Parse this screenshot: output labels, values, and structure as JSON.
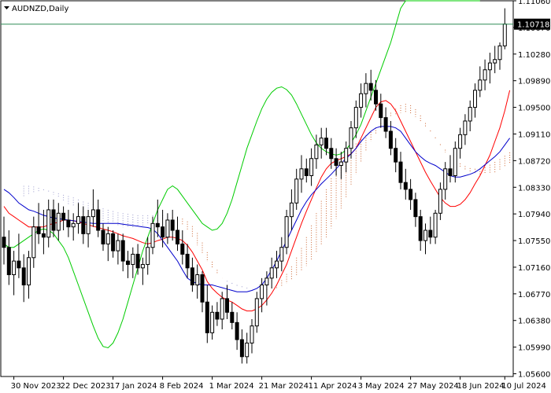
{
  "chart_data": {
    "type": "candlestick",
    "title": "AUDNZD,Daily",
    "symbol": "AUDNZD",
    "timeframe": "Daily",
    "ylim": [
      1.0556,
      1.1106
    ],
    "y_ticks": [
      "1.11060",
      "1.10670",
      "1.10280",
      "1.09890",
      "1.09500",
      "1.09110",
      "1.08720",
      "1.08330",
      "1.07940",
      "1.07550",
      "1.07160",
      "1.06770",
      "1.06380",
      "1.05990",
      "1.05600"
    ],
    "current_price": "1.10718",
    "x_ticks": [
      "30 Nov 2023",
      "22 Dec 2023",
      "17 Jan 2024",
      "8 Feb 2024",
      "1 Mar 2024",
      "21 Mar 2024",
      "11 Apr 2024",
      "3 May 2024",
      "27 May 2024",
      "18 Jun 2024",
      "10 Jul 2024"
    ],
    "candles": [
      {
        "o": 1.076,
        "h": 1.079,
        "l": 1.072,
        "c": 1.0745
      },
      {
        "o": 1.0745,
        "h": 1.077,
        "l": 1.069,
        "c": 1.0705
      },
      {
        "o": 1.0705,
        "h": 1.074,
        "l": 1.0675,
        "c": 1.0725
      },
      {
        "o": 1.0725,
        "h": 1.0765,
        "l": 1.07,
        "c": 1.0715
      },
      {
        "o": 1.0715,
        "h": 1.0735,
        "l": 1.0665,
        "c": 1.069
      },
      {
        "o": 1.069,
        "h": 1.074,
        "l": 1.067,
        "c": 1.073
      },
      {
        "o": 1.073,
        "h": 1.079,
        "l": 1.0715,
        "c": 1.0775
      },
      {
        "o": 1.0775,
        "h": 1.081,
        "l": 1.075,
        "c": 1.0765
      },
      {
        "o": 1.0765,
        "h": 1.08,
        "l": 1.0735,
        "c": 1.076
      },
      {
        "o": 1.076,
        "h": 1.0815,
        "l": 1.0745,
        "c": 1.08
      },
      {
        "o": 1.08,
        "h": 1.0815,
        "l": 1.076,
        "c": 1.077
      },
      {
        "o": 1.077,
        "h": 1.081,
        "l": 1.0755,
        "c": 1.0795
      },
      {
        "o": 1.0795,
        "h": 1.0805,
        "l": 1.077,
        "c": 1.0785
      },
      {
        "o": 1.0785,
        "h": 1.08,
        "l": 1.076,
        "c": 1.0775
      },
      {
        "o": 1.0775,
        "h": 1.0795,
        "l": 1.0755,
        "c": 1.078
      },
      {
        "o": 1.078,
        "h": 1.081,
        "l": 1.0765,
        "c": 1.079
      },
      {
        "o": 1.079,
        "h": 1.0805,
        "l": 1.075,
        "c": 1.0765
      },
      {
        "o": 1.0765,
        "h": 1.08,
        "l": 1.0745,
        "c": 1.079
      },
      {
        "o": 1.079,
        "h": 1.083,
        "l": 1.0775,
        "c": 1.08
      },
      {
        "o": 1.08,
        "h": 1.0815,
        "l": 1.076,
        "c": 1.077
      },
      {
        "o": 1.077,
        "h": 1.078,
        "l": 1.074,
        "c": 1.075
      },
      {
        "o": 1.075,
        "h": 1.0775,
        "l": 1.0725,
        "c": 1.0765
      },
      {
        "o": 1.0765,
        "h": 1.077,
        "l": 1.073,
        "c": 1.074
      },
      {
        "o": 1.074,
        "h": 1.0765,
        "l": 1.072,
        "c": 1.0755
      },
      {
        "o": 1.0755,
        "h": 1.0765,
        "l": 1.071,
        "c": 1.0725
      },
      {
        "o": 1.0725,
        "h": 1.074,
        "l": 1.07,
        "c": 1.072
      },
      {
        "o": 1.072,
        "h": 1.0745,
        "l": 1.07,
        "c": 1.0735
      },
      {
        "o": 1.0735,
        "h": 1.075,
        "l": 1.0705,
        "c": 1.0715
      },
      {
        "o": 1.0715,
        "h": 1.073,
        "l": 1.069,
        "c": 1.072
      },
      {
        "o": 1.072,
        "h": 1.076,
        "l": 1.0705,
        "c": 1.0745
      },
      {
        "o": 1.0745,
        "h": 1.079,
        "l": 1.0735,
        "c": 1.078
      },
      {
        "o": 1.078,
        "h": 1.0815,
        "l": 1.076,
        "c": 1.0775
      },
      {
        "o": 1.0775,
        "h": 1.08,
        "l": 1.0745,
        "c": 1.076
      },
      {
        "o": 1.076,
        "h": 1.0795,
        "l": 1.075,
        "c": 1.0785
      },
      {
        "o": 1.0785,
        "h": 1.08,
        "l": 1.0755,
        "c": 1.077
      },
      {
        "o": 1.077,
        "h": 1.079,
        "l": 1.074,
        "c": 1.075
      },
      {
        "o": 1.075,
        "h": 1.077,
        "l": 1.072,
        "c": 1.0735
      },
      {
        "o": 1.0735,
        "h": 1.075,
        "l": 1.07,
        "c": 1.0715
      },
      {
        "o": 1.0715,
        "h": 1.073,
        "l": 1.068,
        "c": 1.069
      },
      {
        "o": 1.069,
        "h": 1.072,
        "l": 1.067,
        "c": 1.0705
      },
      {
        "o": 1.0705,
        "h": 1.071,
        "l": 1.065,
        "c": 1.0665
      },
      {
        "o": 1.0665,
        "h": 1.069,
        "l": 1.0605,
        "c": 1.062
      },
      {
        "o": 1.062,
        "h": 1.066,
        "l": 1.061,
        "c": 1.065
      },
      {
        "o": 1.065,
        "h": 1.0665,
        "l": 1.063,
        "c": 1.064
      },
      {
        "o": 1.064,
        "h": 1.068,
        "l": 1.0625,
        "c": 1.067
      },
      {
        "o": 1.067,
        "h": 1.069,
        "l": 1.064,
        "c": 1.065
      },
      {
        "o": 1.065,
        "h": 1.0665,
        "l": 1.0625,
        "c": 1.0635
      },
      {
        "o": 1.0635,
        "h": 1.065,
        "l": 1.0595,
        "c": 1.061
      },
      {
        "o": 1.061,
        "h": 1.0625,
        "l": 1.0575,
        "c": 1.0585
      },
      {
        "o": 1.0585,
        "h": 1.062,
        "l": 1.0575,
        "c": 1.0605
      },
      {
        "o": 1.0605,
        "h": 1.064,
        "l": 1.059,
        "c": 1.063
      },
      {
        "o": 1.063,
        "h": 1.068,
        "l": 1.062,
        "c": 1.067
      },
      {
        "o": 1.067,
        "h": 1.07,
        "l": 1.065,
        "c": 1.069
      },
      {
        "o": 1.069,
        "h": 1.071,
        "l": 1.066,
        "c": 1.07
      },
      {
        "o": 1.07,
        "h": 1.073,
        "l": 1.0685,
        "c": 1.0715
      },
      {
        "o": 1.0715,
        "h": 1.074,
        "l": 1.07,
        "c": 1.0725
      },
      {
        "o": 1.0725,
        "h": 1.076,
        "l": 1.071,
        "c": 1.0745
      },
      {
        "o": 1.0745,
        "h": 1.08,
        "l": 1.0735,
        "c": 1.079
      },
      {
        "o": 1.079,
        "h": 1.083,
        "l": 1.077,
        "c": 1.081
      },
      {
        "o": 1.081,
        "h": 1.086,
        "l": 1.08,
        "c": 1.0845
      },
      {
        "o": 1.0845,
        "h": 1.088,
        "l": 1.0825,
        "c": 1.086
      },
      {
        "o": 1.086,
        "h": 1.0875,
        "l": 1.084,
        "c": 1.085
      },
      {
        "o": 1.085,
        "h": 1.089,
        "l": 1.0835,
        "c": 1.0875
      },
      {
        "o": 1.0875,
        "h": 1.091,
        "l": 1.086,
        "c": 1.0895
      },
      {
        "o": 1.0895,
        "h": 1.092,
        "l": 1.0875,
        "c": 1.0905
      },
      {
        "o": 1.0905,
        "h": 1.092,
        "l": 1.088,
        "c": 1.089
      },
      {
        "o": 1.089,
        "h": 1.0905,
        "l": 1.086,
        "c": 1.0875
      },
      {
        "o": 1.0875,
        "h": 1.089,
        "l": 1.085,
        "c": 1.0865
      },
      {
        "o": 1.0865,
        "h": 1.0885,
        "l": 1.0845,
        "c": 1.087
      },
      {
        "o": 1.087,
        "h": 1.09,
        "l": 1.0855,
        "c": 1.089
      },
      {
        "o": 1.089,
        "h": 1.093,
        "l": 1.0875,
        "c": 1.092
      },
      {
        "o": 1.092,
        "h": 1.096,
        "l": 1.0905,
        "c": 1.095
      },
      {
        "o": 1.095,
        "h": 1.0985,
        "l": 1.0935,
        "c": 1.097
      },
      {
        "o": 1.097,
        "h": 1.1,
        "l": 1.095,
        "c": 1.0985
      },
      {
        "o": 1.0985,
        "h": 1.1005,
        "l": 1.096,
        "c": 1.0975
      },
      {
        "o": 1.0975,
        "h": 1.099,
        "l": 1.0945,
        "c": 1.0955
      },
      {
        "o": 1.0955,
        "h": 1.097,
        "l": 1.092,
        "c": 1.0935
      },
      {
        "o": 1.0935,
        "h": 1.095,
        "l": 1.0905,
        "c": 1.0915
      },
      {
        "o": 1.0915,
        "h": 1.093,
        "l": 1.088,
        "c": 1.089
      },
      {
        "o": 1.089,
        "h": 1.0905,
        "l": 1.0855,
        "c": 1.087
      },
      {
        "o": 1.087,
        "h": 1.0885,
        "l": 1.083,
        "c": 1.084
      },
      {
        "o": 1.084,
        "h": 1.086,
        "l": 1.0815,
        "c": 1.083
      },
      {
        "o": 1.083,
        "h": 1.0845,
        "l": 1.08,
        "c": 1.0815
      },
      {
        "o": 1.0815,
        "h": 1.0825,
        "l": 1.0775,
        "c": 1.079
      },
      {
        "o": 1.079,
        "h": 1.08,
        "l": 1.074,
        "c": 1.0755
      },
      {
        "o": 1.0755,
        "h": 1.078,
        "l": 1.0735,
        "c": 1.077
      },
      {
        "o": 1.077,
        "h": 1.079,
        "l": 1.075,
        "c": 1.076
      },
      {
        "o": 1.076,
        "h": 1.08,
        "l": 1.075,
        "c": 1.0795
      },
      {
        "o": 1.0795,
        "h": 1.084,
        "l": 1.0785,
        "c": 1.083
      },
      {
        "o": 1.083,
        "h": 1.087,
        "l": 1.0815,
        "c": 1.086
      },
      {
        "o": 1.086,
        "h": 1.088,
        "l": 1.084,
        "c": 1.085
      },
      {
        "o": 1.085,
        "h": 1.09,
        "l": 1.084,
        "c": 1.089
      },
      {
        "o": 1.089,
        "h": 1.092,
        "l": 1.0875,
        "c": 1.091
      },
      {
        "o": 1.091,
        "h": 1.094,
        "l": 1.0895,
        "c": 1.093
      },
      {
        "o": 1.093,
        "h": 1.096,
        "l": 1.0915,
        "c": 1.095
      },
      {
        "o": 1.095,
        "h": 1.0985,
        "l": 1.0935,
        "c": 1.0975
      },
      {
        "o": 1.0975,
        "h": 1.101,
        "l": 1.0965,
        "c": 1.099
      },
      {
        "o": 1.099,
        "h": 1.102,
        "l": 1.0975,
        "c": 1.1005
      },
      {
        "o": 1.1005,
        "h": 1.103,
        "l": 1.0985,
        "c": 1.1015
      },
      {
        "o": 1.1015,
        "h": 1.104,
        "l": 1.1,
        "c": 1.102
      },
      {
        "o": 1.102,
        "h": 1.1045,
        "l": 1.1005,
        "c": 1.104
      },
      {
        "o": 1.104,
        "h": 1.1095,
        "l": 1.1035,
        "c": 1.1072
      }
    ],
    "series": [
      {
        "values": [
          1.0805,
          1.0795,
          1.079,
          1.0785,
          1.078,
          1.0775,
          1.0775,
          1.0775,
          1.0775,
          1.0778,
          1.078,
          1.0782,
          1.0785,
          1.0785,
          1.0784,
          1.0782,
          1.078,
          1.0778,
          1.0776,
          1.0774,
          1.0772,
          1.077,
          1.0768,
          1.0765,
          1.0762,
          1.076,
          1.0758,
          1.0755,
          1.0752,
          1.075,
          1.0752,
          1.0755,
          1.0757,
          1.076,
          1.076,
          1.0758,
          1.0755,
          1.0748,
          1.0738,
          1.0725,
          1.0712,
          1.0695,
          1.0685,
          1.0678,
          1.0672,
          1.0668,
          1.0665,
          1.066,
          1.0655,
          1.0652,
          1.0652,
          1.0655,
          1.066,
          1.0668,
          1.0678,
          1.069,
          1.0705,
          1.072,
          1.074,
          1.076,
          1.078,
          1.0798,
          1.0815,
          1.0832,
          1.0848,
          1.086,
          1.0868,
          1.0872,
          1.0875,
          1.0878,
          1.0882,
          1.089,
          1.0905,
          1.092,
          1.0935,
          1.095,
          1.0958,
          1.096,
          1.0955,
          1.0945,
          1.093,
          1.0915,
          1.09,
          1.0885,
          1.087,
          1.0855,
          1.0842,
          1.083,
          1.0818,
          1.081,
          1.0805,
          1.0805,
          1.0808,
          1.0815,
          1.0825,
          1.0838,
          1.085,
          1.0865,
          1.088,
          1.09,
          1.092,
          1.0945,
          1.0975
        ]
      },
      {
        "values": [
          1.083,
          1.0825,
          1.0818,
          1.081,
          1.0805,
          1.08,
          1.0798,
          1.0795,
          1.0792,
          1.079,
          1.0788,
          1.0787,
          1.0786,
          1.0785,
          1.0784,
          1.0783,
          1.0782,
          1.0781,
          1.078,
          1.078,
          1.078,
          1.078,
          1.078,
          1.078,
          1.0779,
          1.0778,
          1.0777,
          1.0776,
          1.0775,
          1.0774,
          1.0772,
          1.0765,
          1.0755,
          1.0745,
          1.0735,
          1.0725,
          1.0712,
          1.07,
          1.0695,
          1.0692,
          1.069,
          1.069,
          1.069,
          1.0688,
          1.0686,
          1.0684,
          1.0682,
          1.068,
          1.068,
          1.068,
          1.0682,
          1.0685,
          1.069,
          1.07,
          1.0712,
          1.0725,
          1.074,
          1.0755,
          1.077,
          1.0785,
          1.08,
          1.0812,
          1.0822,
          1.083,
          1.0838,
          1.0845,
          1.0852,
          1.086,
          1.0868,
          1.0875,
          1.0882,
          1.089,
          1.09,
          1.0908,
          1.0915,
          1.092,
          1.0922,
          1.0922,
          1.0922,
          1.092,
          1.0915,
          1.0905,
          1.0895,
          1.0885,
          1.0878,
          1.0872,
          1.0868,
          1.0865,
          1.086,
          1.0855,
          1.085,
          1.0848,
          1.0848,
          1.085,
          1.0852,
          1.0855,
          1.086,
          1.0866,
          1.0872,
          1.0878,
          1.0885,
          1.0895,
          1.0905
        ]
      },
      {
        "values": [
          1.08,
          1.079,
          1.078,
          1.077,
          1.076,
          1.0755,
          1.075,
          1.0745,
          1.0745,
          1.075,
          1.0755,
          1.076,
          1.0765,
          1.077,
          1.0772,
          1.077,
          1.0765,
          1.0755,
          1.0745,
          1.073,
          1.071,
          1.069,
          1.067,
          1.065,
          1.063,
          1.0612,
          1.06,
          1.0598,
          1.0605,
          1.062,
          1.064,
          1.0665,
          1.069,
          1.0715,
          1.074,
          1.076,
          1.078,
          1.08,
          1.0815,
          1.083,
          1.0835,
          1.083,
          1.082,
          1.081,
          1.08,
          1.079,
          1.078,
          1.0775,
          1.077,
          1.0772,
          1.078,
          1.0795,
          1.0815,
          1.084,
          1.0865,
          1.089,
          1.091,
          1.093,
          1.0948,
          1.0962,
          1.0972,
          1.0978,
          1.098,
          1.0976,
          1.0968,
          1.0955,
          1.094,
          1.0925,
          1.091,
          1.0898,
          1.089,
          1.0885,
          1.0882,
          1.088,
          1.0882,
          1.0888,
          1.0898,
          1.091,
          1.0925,
          1.0945,
          1.0965,
          1.0985,
          1.1005,
          1.1025,
          1.1045,
          1.107,
          1.1095,
          1.111,
          1.111,
          1.111,
          1.111,
          1.111,
          1.111,
          1.111,
          1.111,
          1.111,
          1.111,
          1.111,
          1.111,
          1.111,
          1.111,
          1.111,
          1.111
        ]
      }
    ],
    "cloud": {
      "span_a": [
        1.082,
        1.0822,
        1.0824,
        1.0826,
        1.0828,
        1.0826,
        1.0822,
        1.0818,
        1.0812,
        1.0808,
        1.0805,
        1.08,
        1.0796,
        1.0792,
        1.0789,
        1.0786,
        1.0783,
        1.078,
        1.0778,
        1.0776,
        1.0774,
        1.0774,
        1.0774,
        1.0775,
        1.0776,
        1.0778,
        1.078,
        1.0782,
        1.0785,
        1.0787,
        1.0789,
        1.0789,
        1.0787,
        1.0783,
        1.0776,
        1.0766,
        1.0752,
        1.0738,
        1.0724,
        1.0712,
        1.07,
        1.0695,
        1.069,
        1.0688,
        1.0686,
        1.0685,
        1.0684,
        1.0683,
        1.0683,
        1.0684,
        1.0686,
        1.069,
        1.0697,
        1.0706,
        1.0717,
        1.073,
        1.0744,
        1.076,
        1.0777,
        1.0795,
        1.0813,
        1.083,
        1.0846,
        1.086,
        1.0872,
        1.0882,
        1.089,
        1.0897,
        1.0903,
        1.0909,
        1.0914,
        1.092,
        1.0927,
        1.0935,
        1.0942,
        1.0948,
        1.0953,
        1.0955,
        1.0953,
        1.0947,
        1.0938,
        1.0927,
        1.0916,
        1.0906,
        1.0896,
        1.0888,
        1.088,
        1.0874,
        1.0868,
        1.0864,
        1.0861,
        1.086,
        1.086,
        1.0862,
        1.0866,
        1.087,
        1.0874,
        1.0879,
        1.0884,
        1.0889,
        1.0894,
        1.09,
        1.0908
      ],
      "span_b": [
        1.0835,
        1.0835,
        1.0834,
        1.0832,
        1.083,
        1.0828,
        1.0826,
        1.0824,
        1.0822,
        1.082,
        1.0818,
        1.0815,
        1.0812,
        1.081,
        1.0808,
        1.0805,
        1.0802,
        1.08,
        1.0798,
        1.0796,
        1.0795,
        1.0794,
        1.0793,
        1.0792,
        1.0792,
        1.0792,
        1.0792,
        1.0792,
        1.0792,
        1.079,
        1.0788,
        1.0784,
        1.0778,
        1.077,
        1.076,
        1.0748,
        1.0736,
        1.0724,
        1.0714,
        1.0706,
        1.07,
        1.0696,
        1.0693,
        1.069,
        1.0688,
        1.0686,
        1.0684,
        1.0683,
        1.0682,
        1.0682,
        1.0683,
        1.0685,
        1.0688,
        1.0692,
        1.0697,
        1.0703,
        1.071,
        1.0718,
        1.0727,
        1.0737,
        1.0748,
        1.076,
        1.0773,
        1.0787,
        1.0802,
        1.0818,
        1.0835,
        1.0852,
        1.087,
        1.0886,
        1.09,
        1.0912,
        1.0922,
        1.093,
        1.0936,
        1.094,
        1.0942,
        1.0942,
        1.094,
        1.0936,
        1.093,
        1.0922,
        1.0913,
        1.0903,
        1.0893,
        1.0884,
        1.0876,
        1.0869,
        1.0863,
        1.0858,
        1.0855,
        1.0853,
        1.0852,
        1.0852,
        1.0853,
        1.0855,
        1.0858,
        1.0862,
        1.0867,
        1.0872,
        1.0878,
        1.0884,
        1.0892
      ]
    },
    "colors": {
      "background": "#ffffff",
      "candle": "#000000",
      "tenkan": "#ff0000",
      "kijun": "#0000cc",
      "chikou": "#00cc00",
      "cloud_bull": "#cc6633",
      "cloud_bear": "#9999cc",
      "price_line": "#2e8b57",
      "price_label_bg": "#000000",
      "price_label_text": "#ffffff"
    }
  }
}
